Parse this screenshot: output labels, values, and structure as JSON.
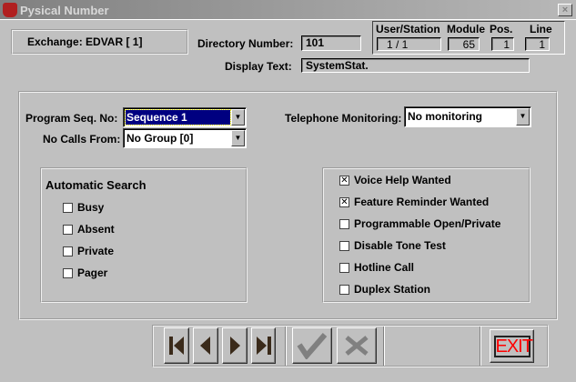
{
  "window": {
    "title": "Pysical Number",
    "close": "×"
  },
  "header": {
    "exchange": "Exchange:  EDVAR  [ 1]",
    "directory_label": "Directory Number:",
    "directory_value": "101",
    "display_label": "Display Text:",
    "display_value": "SystemStat.",
    "station": {
      "headers": [
        "User/Station",
        "Module",
        "Pos.",
        "Line"
      ],
      "values": [
        "1 /   1",
        "65",
        "1",
        "1"
      ]
    }
  },
  "form": {
    "program_seq_label": "Program Seq. No:",
    "program_seq_value": "Sequence 1",
    "no_calls_label": "No Calls From:",
    "no_calls_value": "No Group [0]",
    "monitoring_label": "Telephone Monitoring:",
    "monitoring_value": "No monitoring"
  },
  "auto_search": {
    "title": "Automatic Search",
    "items": [
      {
        "label": "Busy",
        "checked": false
      },
      {
        "label": "Absent",
        "checked": false
      },
      {
        "label": "Private",
        "checked": false
      },
      {
        "label": "Pager",
        "checked": false
      }
    ]
  },
  "options": {
    "items": [
      {
        "label": "Voice Help Wanted",
        "checked": true
      },
      {
        "label": "Feature Reminder Wanted",
        "checked": true
      },
      {
        "label": "Programmable Open/Private",
        "checked": false
      },
      {
        "label": "Disable Tone Test",
        "checked": false
      },
      {
        "label": "Hotline Call",
        "checked": false
      },
      {
        "label": "Duplex Station",
        "checked": false
      }
    ]
  },
  "toolbar": {
    "exit_label": "EXIT",
    "icons": [
      "first-icon",
      "prev-icon",
      "next-icon",
      "last-icon",
      "check-icon",
      "cancel-icon",
      "exit-icon"
    ],
    "exit_color": "#ff0000"
  }
}
